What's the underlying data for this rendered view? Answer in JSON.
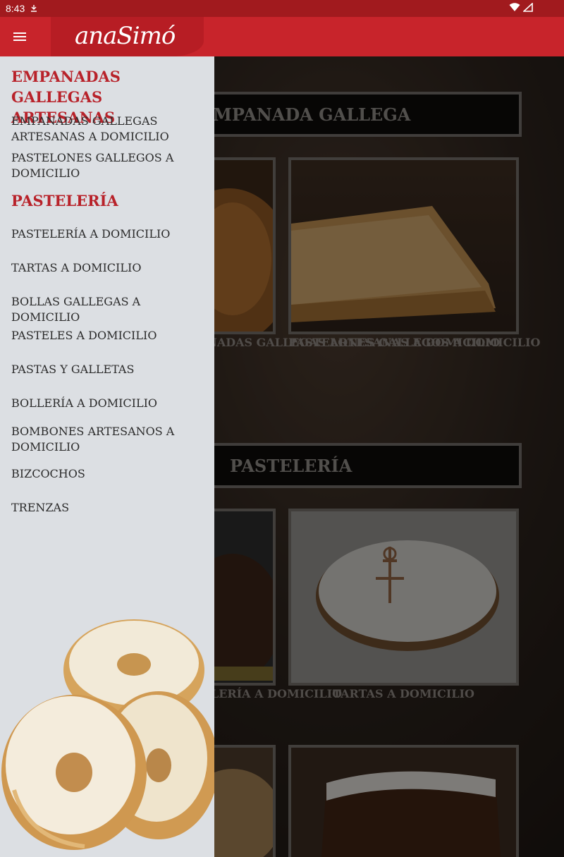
{
  "status_bar": {
    "time": "8:43"
  },
  "app_bar": {
    "logo_text": "anaSimó"
  },
  "content": {
    "sections": [
      {
        "title": "EMPANADA GALLEGA",
        "tiles": [
          "EMPANADAS GALLEGAS ARTESANAS A DOMICILIO",
          "PASTELONES GALLEGOS A DOMICILIO"
        ]
      },
      {
        "title": "PASTELERÍA",
        "tiles": [
          "PASTELERÍA A DOMICILIO",
          "TARTAS A DOMICILIO"
        ]
      }
    ]
  },
  "drawer": {
    "categories": [
      {
        "title": "EMPANADAS GALLEGAS ARTESANAS",
        "items": [
          "EMPANADAS GALLEGAS ARTESANAS A DOMICILIO",
          "PASTELONES GALLEGOS A DOMICILIO"
        ]
      },
      {
        "title": "PASTELERÍA",
        "items": [
          "PASTELERÍA A DOMICILIO",
          "TARTAS A DOMICILIO",
          "BOLLAS GALLEGAS A DOMICILIO",
          "PASTELES A DOMICILIO",
          "PASTAS Y GALLETAS",
          "BOLLERÍA A DOMICILIO",
          "BOMBONES ARTESANOS A DOMICILIO",
          "BIZCOCHOS",
          "TRENZAS"
        ]
      }
    ]
  },
  "colors": {
    "brand_red": "#c8242b",
    "status_red": "#a11a1e",
    "drawer_bg": "#dcdfe3",
    "category_red": "#b8222a"
  }
}
